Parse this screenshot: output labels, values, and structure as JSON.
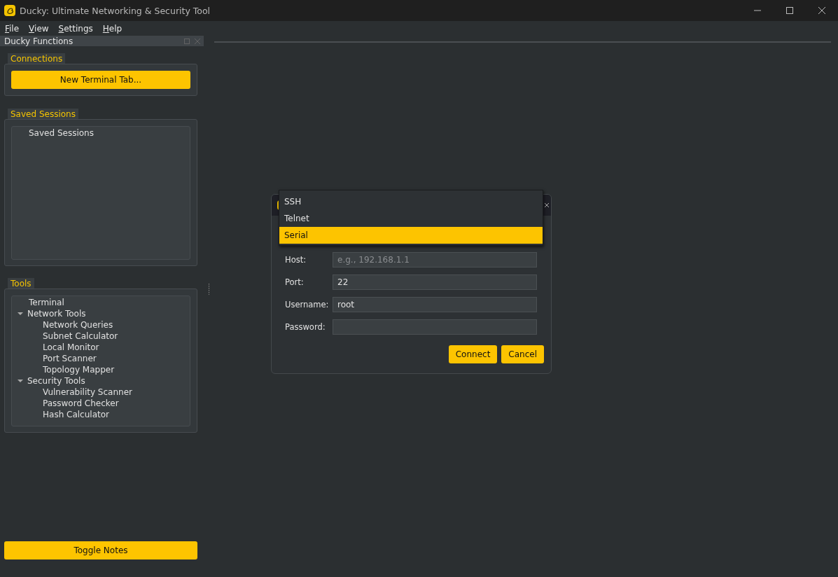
{
  "window": {
    "title": "Ducky: Ultimate Networking & Security Tool"
  },
  "menu": [
    "File",
    "View",
    "Settings",
    "Help"
  ],
  "dock": {
    "title": "Ducky Functions",
    "connections": {
      "title": "Connections",
      "button": "New Terminal Tab..."
    },
    "saved_sessions": {
      "title": "Saved Sessions",
      "items": [
        {
          "label": "Saved Sessions"
        }
      ]
    },
    "tools": {
      "title": "Tools",
      "items": [
        {
          "label": "Terminal"
        },
        {
          "label": "Network Tools",
          "expanded": true,
          "children": [
            {
              "label": "Network Queries"
            },
            {
              "label": "Subnet Calculator"
            },
            {
              "label": "Local Monitor"
            },
            {
              "label": "Port Scanner"
            },
            {
              "label": "Topology Mapper"
            }
          ]
        },
        {
          "label": "Security Tools",
          "expanded": true,
          "children": [
            {
              "label": "Vulnerability Scanner"
            },
            {
              "label": "Password Checker"
            },
            {
              "label": "Hash Calculator"
            }
          ]
        }
      ]
    },
    "toggle_button": "Toggle Notes"
  },
  "dialog": {
    "fields": [
      {
        "label": "Host:",
        "placeholder": "e.g., 192.168.1.1"
      },
      {
        "label": "Port:",
        "value": "22"
      },
      {
        "label": "Username:",
        "value": "root"
      },
      {
        "label": "Password:"
      }
    ],
    "buttons": [
      "Connect",
      "Cancel"
    ]
  },
  "dropdown": {
    "options": [
      {
        "label": "SSH",
        "selected": false
      },
      {
        "label": "Telnet",
        "selected": false
      },
      {
        "label": "Serial",
        "selected": true
      }
    ]
  }
}
